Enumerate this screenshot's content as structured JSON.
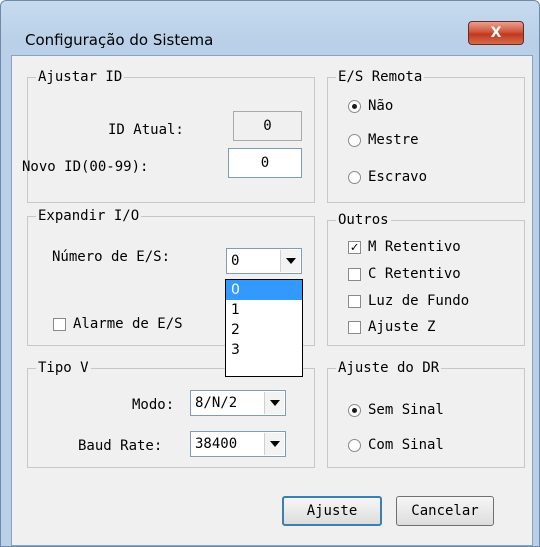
{
  "window": {
    "title": "Configuração do Sistema",
    "close_glyph": "X"
  },
  "ajustar_id": {
    "title": "Ajustar ID",
    "current_label": "ID Atual:",
    "current_value": "0",
    "new_label": "Novo ID(00-99):",
    "new_value": "0"
  },
  "es_remota": {
    "title": "E/S Remota",
    "options": [
      {
        "label": "Não",
        "checked": true
      },
      {
        "label": "Mestre",
        "checked": false
      },
      {
        "label": "Escravo",
        "checked": false
      }
    ]
  },
  "expandir_io": {
    "title": "Expandir I/O",
    "count_label": "Número de E/S:",
    "count_value": "0",
    "dropdown_options": [
      "0",
      "1",
      "2",
      "3"
    ],
    "dropdown_selected": "0",
    "alarm_label": "Alarme de E/S"
  },
  "outros": {
    "title": "Outros",
    "items": [
      {
        "label": "M  Retentivo",
        "checked": true
      },
      {
        "label": "C Retentivo",
        "checked": false
      },
      {
        "label": "Luz de Fundo",
        "checked": false
      },
      {
        "label": "Ajuste Z",
        "checked": false
      }
    ]
  },
  "tipo_v": {
    "title": "Tipo V",
    "mode_label": "Modo:",
    "mode_value": "8/N/2",
    "baud_label": "Baud Rate:",
    "baud_value": "38400"
  },
  "ajuste_dr": {
    "title": "Ajuste do DR",
    "options": [
      {
        "label": "Sem Sinal",
        "checked": true
      },
      {
        "label": "Com Sinal",
        "checked": false
      }
    ]
  },
  "buttons": {
    "ok_label": "Ajuste",
    "cancel_label": "Cancelar"
  },
  "icons": {
    "close": "close-icon",
    "dropdown_arrow": "chevron-down-icon",
    "checkmark": "checkmark-icon"
  }
}
